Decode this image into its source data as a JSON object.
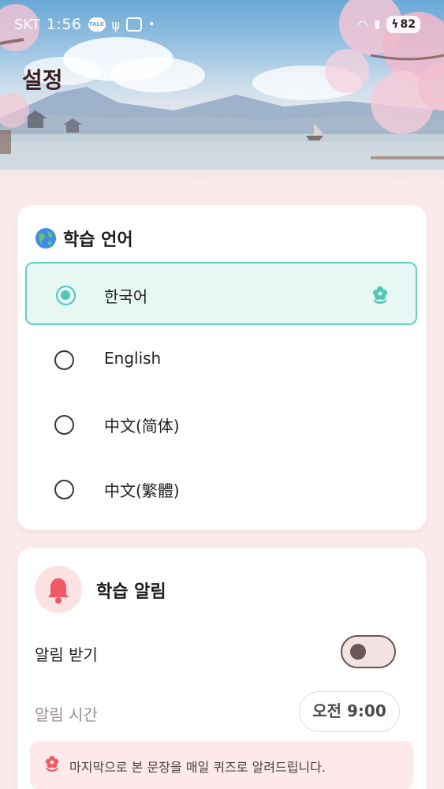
{
  "status_bar": {
    "carrier": "SKT",
    "time": "1:56",
    "talk_badge": "TALK",
    "battery": "82"
  },
  "page": {
    "title": "설정"
  },
  "language_section": {
    "title": "학습 언어",
    "options": [
      {
        "label": "한국어",
        "selected": true
      },
      {
        "label": "English",
        "selected": false
      },
      {
        "label": "中文(简体)",
        "selected": false
      },
      {
        "label": "中文(繁體)",
        "selected": false
      }
    ]
  },
  "notification_section": {
    "title": "학습 알림",
    "receive_label": "알림 받기",
    "receive_enabled": false,
    "time_label": "알림 시간",
    "time_value": "오전 9:00",
    "note": "마지막으로 본 문장을 매일 퀴즈로 알려드립니다."
  },
  "colors": {
    "accent": "#4fc9b7",
    "background": "#fbeaeb",
    "note_bg": "#fde9ea",
    "bell": "#ef5a66"
  }
}
